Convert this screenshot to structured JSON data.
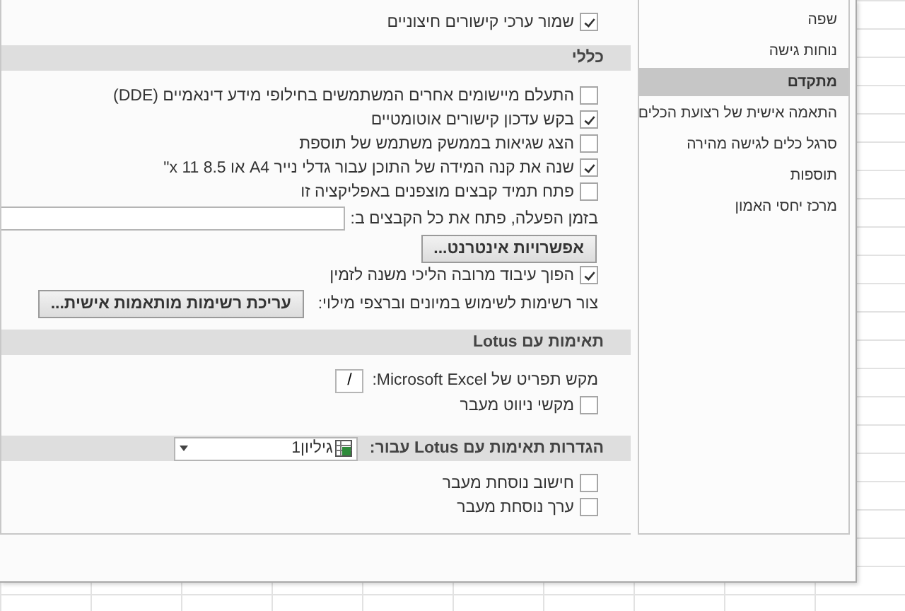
{
  "content": [
    {
      "kind": "checkbox",
      "label": "שמור ערכי קישורים חיצוניים",
      "checked": true
    },
    {
      "kind": "header",
      "label": "כללי"
    },
    {
      "kind": "checkbox",
      "label": "התעלם מיישומים אחרים המשתמשים בחילופי מידע דינאמיים (DDE)",
      "checked": false
    },
    {
      "kind": "checkbox",
      "label": "בקש עדכון קישורים אוטומטיים",
      "checked": true
    },
    {
      "kind": "checkbox",
      "label": "הצג שגיאות בממשק משתמש של תוספת",
      "checked": false
    },
    {
      "kind": "checkbox",
      "label": "שנה את קנה המידה של התוכן עבור גדלי נייר A4 או 8.5 x 11\"",
      "checked": true
    },
    {
      "kind": "checkbox",
      "label": "פתח תמיד קבצים מוצפנים באפליקציה זו",
      "checked": false
    },
    {
      "kind": "field",
      "label": "בזמן הפעלה, פתח את כל הקבצים ב:"
    },
    {
      "kind": "button",
      "label": "אפשרויות אינטרנט..."
    },
    {
      "kind": "checkbox",
      "label": "הפוך עיבוד מרובה הליכי משנה לזמין",
      "checked": true
    },
    {
      "kind": "list",
      "label": "צור רשימות לשימוש במיונים וברצפי מילוי:",
      "button": "עריכת רשימות מותאמות אישית..."
    },
    {
      "kind": "header",
      "label": "תאימות עם Lotus"
    },
    {
      "kind": "key",
      "label": "מקש תפריט של Microsoft Excel:",
      "value": "/"
    },
    {
      "kind": "checkbox",
      "label": "מקשי ניווט מעבר",
      "checked": false
    },
    {
      "kind": "sheet_header",
      "label": "הגדרות תאימות עם Lotus עבור:",
      "value": "גיליון1"
    },
    {
      "kind": "checkbox",
      "label": "חישוב נוסחת מעבר",
      "checked": false
    },
    {
      "kind": "checkbox",
      "label": "ערך נוסחת מעבר",
      "checked": false
    }
  ],
  "sidebar": {
    "items": [
      {
        "label": "שפה",
        "selected": false
      },
      {
        "label": "נוחות גישה",
        "selected": false
      },
      {
        "label": "מתקדם",
        "selected": true
      },
      {
        "label": "התאמה אישית של רצועת הכלים",
        "selected": false
      },
      {
        "label": "סרגל כלים לגישה מהירה",
        "selected": false
      },
      {
        "label": "תוספות",
        "selected": false
      },
      {
        "label": "מרכז יחסי האמון",
        "selected": false
      }
    ]
  }
}
